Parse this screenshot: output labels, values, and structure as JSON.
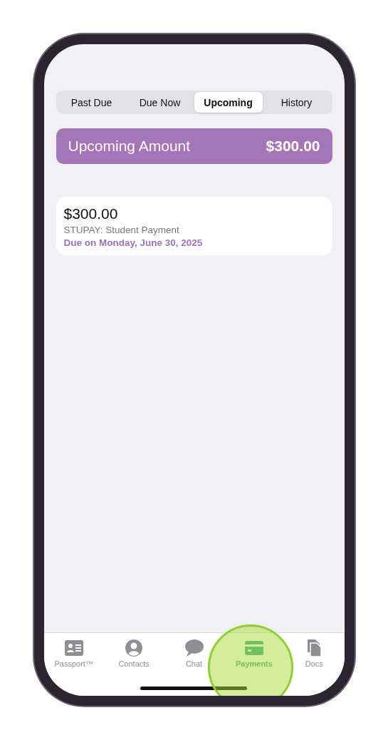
{
  "segments": [
    {
      "label": "Past Due",
      "selected": false
    },
    {
      "label": "Due Now",
      "selected": false
    },
    {
      "label": "Upcoming",
      "selected": true
    },
    {
      "label": "History",
      "selected": false
    }
  ],
  "summary": {
    "label": "Upcoming Amount",
    "amount": "$300.00"
  },
  "payments": [
    {
      "amount": "$300.00",
      "description": "STUPAY: Student Payment",
      "due": "Due on Monday, June 30, 2025"
    }
  ],
  "tab_bar": [
    {
      "label": "Passport™",
      "kind": "idcard",
      "selected": false
    },
    {
      "label": "Contacts",
      "kind": "person",
      "selected": false
    },
    {
      "label": "Chat",
      "kind": "bubble",
      "selected": false
    },
    {
      "label": "Payments",
      "kind": "card",
      "selected": true
    },
    {
      "label": "Docs",
      "kind": "docs",
      "selected": false
    }
  ],
  "highlight": {
    "on": true
  }
}
